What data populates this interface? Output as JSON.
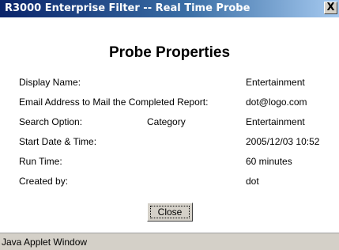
{
  "window": {
    "title": "R3000 Enterprise Filter -- Real Time Probe",
    "close_symbol": "X"
  },
  "dialog": {
    "heading": "Probe Properties",
    "rows": [
      {
        "label": "Display Name:",
        "mid": "",
        "value": "Entertainment"
      },
      {
        "label": "Email Address to Mail the Completed Report:",
        "mid": "",
        "value": "dot@logo.com"
      },
      {
        "label": "Search Option:",
        "mid": "Category",
        "value": "Entertainment"
      },
      {
        "label": "Start Date & Time:",
        "mid": "",
        "value": "2005/12/03 10:52"
      },
      {
        "label": "Run Time:",
        "mid": "",
        "value": "60 minutes"
      },
      {
        "label": "Created by:",
        "mid": "",
        "value": "dot"
      }
    ],
    "close_label": "Close"
  },
  "statusbar": {
    "text": "Java Applet Window"
  }
}
